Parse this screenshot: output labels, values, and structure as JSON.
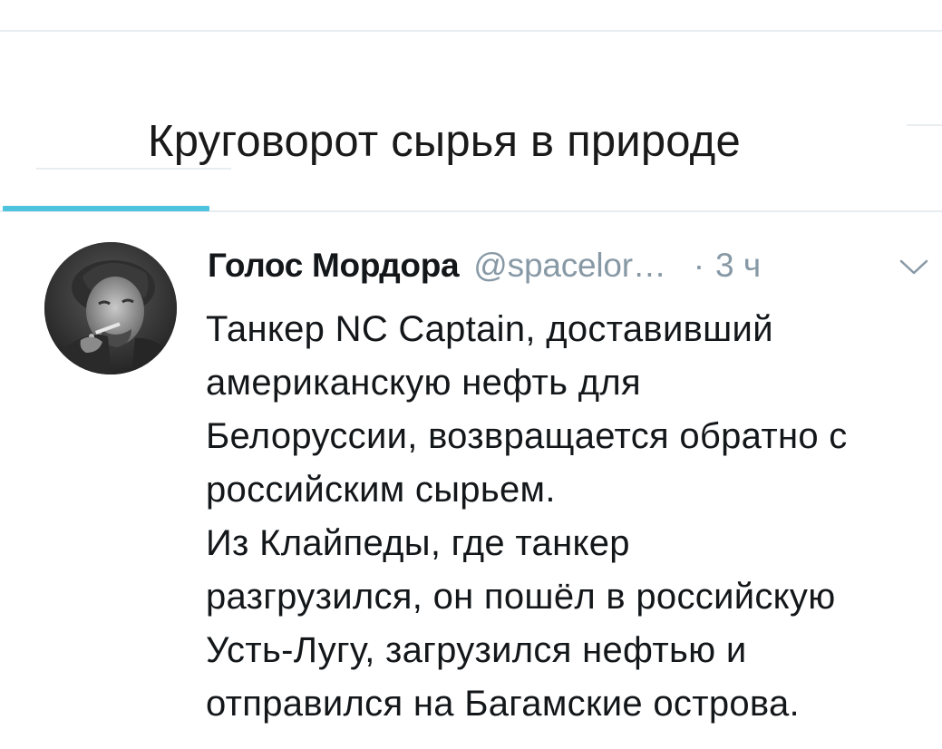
{
  "caption": {
    "text": "Круговорот сырья в природе"
  },
  "tweet": {
    "author": {
      "display_name": "Голос Мордора",
      "handle": "@spacelor…"
    },
    "separator": "·",
    "timestamp": "3 ч",
    "menu_icon": "chevron-down-icon",
    "lines": [
      "Танкер NC Captain, доставивший",
      "американскую нефть для",
      "Белоруссии, возвращается обратно с",
      "российским сырьем.",
      "Из Клайпеды, где танкер",
      "разгрузился, он пошёл в российскую",
      "Усть-Лугу, загрузился нефтью и",
      "отправился на Багамские острова."
    ]
  },
  "colors": {
    "accent": "#4ec3de",
    "text_primary": "#14171a",
    "text_secondary": "#8899a6",
    "divider": "#e6ecf0"
  }
}
